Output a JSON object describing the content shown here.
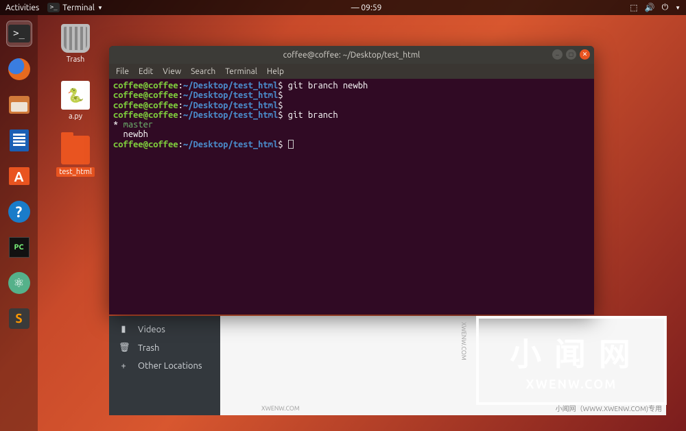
{
  "topbar": {
    "activities": "Activities",
    "app_name": "Terminal",
    "clock": "09:59"
  },
  "dock": {
    "items": [
      {
        "name": "terminal-icon"
      },
      {
        "name": "firefox-icon"
      },
      {
        "name": "files-icon"
      },
      {
        "name": "document-icon"
      },
      {
        "name": "software-icon"
      },
      {
        "name": "help-icon"
      },
      {
        "name": "pycharm-icon"
      },
      {
        "name": "atom-icon"
      },
      {
        "name": "sublime-icon"
      }
    ]
  },
  "desktop": {
    "trash": "Trash",
    "apy": "a.py",
    "folder": "test_html"
  },
  "terminal": {
    "title": "coffee@coffee: ~/Desktop/test_html",
    "menu": [
      "File",
      "Edit",
      "View",
      "Search",
      "Terminal",
      "Help"
    ],
    "prompt_user": "coffee@coffee",
    "prompt_sep1": ":",
    "prompt_path": "~/Desktop/test_html",
    "prompt_dollar": "$",
    "lines": {
      "l1_cmd": " git branch newbh",
      "l2_cmd": "",
      "l3_cmd": "",
      "l4_cmd": " git branch",
      "l5": "* ",
      "l5_branch": "master",
      "l6": "  newbh",
      "l7_cmd": " "
    }
  },
  "files_window": {
    "videos": "Videos",
    "trash": "Trash",
    "other": "Other Locations",
    "footer": "小闻网（WWW.XWENW.COM)专用"
  },
  "watermark": {
    "big": "小 闻 网",
    "sub": "XWENW.COM",
    "side": "XWENW.COM"
  }
}
